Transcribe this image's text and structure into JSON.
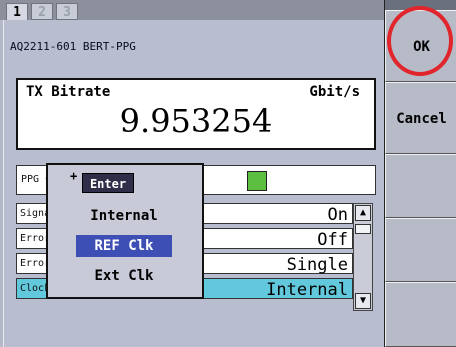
{
  "tabs": [
    {
      "label": "1"
    },
    {
      "label": "2"
    },
    {
      "label": "3"
    }
  ],
  "device_name": "AQ2211-601 BERT-PPG",
  "bitrate": {
    "label": "TX Bitrate",
    "unit": "Gbit/s",
    "value": "9.953254"
  },
  "alarm": {
    "label": "PPG Clock Alarm",
    "led_color": "#5cbf41"
  },
  "params": [
    {
      "label": "Signal",
      "value": "On"
    },
    {
      "label": "Error",
      "value": "Off"
    },
    {
      "label": "Error",
      "value": "Single"
    },
    {
      "label": "Clock Source",
      "value": "Internal"
    }
  ],
  "popup": {
    "enter_mark": "+",
    "enter_label": "Enter",
    "options": [
      "Internal",
      "REF Clk",
      "Ext Clk"
    ],
    "selected": "REF Clk"
  },
  "right_buttons": {
    "ok_label": "OK",
    "cancel_label": "Cancel"
  },
  "colors": {
    "highlight": "#3d4fb5",
    "selected_row": "#62c8dc",
    "ok_circle": "#e0262c"
  }
}
